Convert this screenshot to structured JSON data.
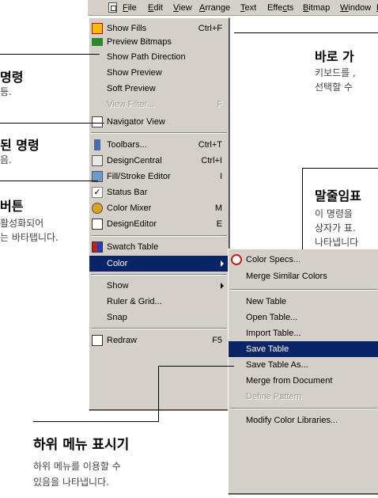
{
  "menubar": {
    "items": [
      {
        "pre": "",
        "u": "F",
        "post": "ile"
      },
      {
        "pre": "",
        "u": "E",
        "post": "dit"
      },
      {
        "pre": "",
        "u": "V",
        "post": "iew"
      },
      {
        "pre": "",
        "u": "A",
        "post": "rrange"
      },
      {
        "pre": "",
        "u": "T",
        "post": "ext"
      },
      {
        "pre": "Effe",
        "u": "c",
        "post": "ts"
      },
      {
        "pre": "",
        "u": "B",
        "post": "itmap"
      },
      {
        "pre": "",
        "u": "W",
        "post": "indow"
      },
      {
        "pre": "",
        "u": "H",
        "post": "elp"
      }
    ]
  },
  "view_menu": {
    "items": [
      {
        "label": "Show Fills",
        "shortcut": "Ctrl+F",
        "icon": "show-fills-icon"
      },
      {
        "label": "Preview Bitmaps",
        "shortcut": "",
        "icon": "preview-bitmaps-icon"
      },
      {
        "label": "Show Path Direction",
        "shortcut": ""
      },
      {
        "label": "Show Preview",
        "shortcut": ""
      },
      {
        "label": "Soft Preview",
        "shortcut": ""
      },
      {
        "label": "View Filter...",
        "shortcut": "F"
      },
      {
        "label": "Navigator View",
        "shortcut": "",
        "icon": "navigator-view-icon"
      },
      {
        "label": "Toolbars...",
        "shortcut": "Ctrl+T",
        "icon": "toolbars-icon"
      },
      {
        "label": "DesignCentral",
        "shortcut": "Ctrl+I",
        "icon": "designcentral-icon"
      },
      {
        "label": "Fill/Stroke Editor",
        "shortcut": "I",
        "icon": "fill-stroke-editor-icon"
      },
      {
        "label": "Status Bar",
        "shortcut": "",
        "icon": "check-icon"
      },
      {
        "label": "Color Mixer",
        "shortcut": "M",
        "icon": "color-mixer-icon"
      },
      {
        "label": "DesignEditor",
        "shortcut": "E",
        "icon": "design-editor-icon"
      },
      {
        "label": "Swatch Table",
        "shortcut": "",
        "icon": "swatch-table-icon"
      },
      {
        "label": "Color",
        "shortcut": ""
      },
      {
        "label": "Show",
        "shortcut": ""
      },
      {
        "label": "Ruler & Grid...",
        "shortcut": ""
      },
      {
        "label": "Snap",
        "shortcut": ""
      },
      {
        "label": "Redraw",
        "shortcut": "F5",
        "icon": "redraw-icon"
      }
    ]
  },
  "color_submenu": {
    "items": [
      {
        "label": "Color Specs...",
        "icon": "color-specs-icon"
      },
      {
        "label": "Merge Similar Colors"
      },
      {
        "label": "New Table"
      },
      {
        "label": "Open Table..."
      },
      {
        "label": "Import Table..."
      },
      {
        "label": "Save Table"
      },
      {
        "label": "Save Table As..."
      },
      {
        "label": "Merge from Document"
      },
      {
        "label": "Define Pattern"
      },
      {
        "label": "Modify Color Libraries..."
      }
    ]
  },
  "callouts": {
    "c1_title": "명령",
    "c1_desc": "등.",
    "c2_title": "된 명령",
    "c2_desc": "음.",
    "c3_title": "버튼",
    "c3_desc1": "활성화되어",
    "c3_desc2": "는 바타탭니다.",
    "c4_title": "바로 가",
    "c4_desc1": "키보드를 ,",
    "c4_desc2": "선택할 수",
    "c5_title": "말줄임표",
    "c5_desc1": "이 명령을",
    "c5_desc2": "상자가 표.",
    "c5_desc3": "나타냅니다",
    "c6_title": "하위 메뉴 표시기",
    "c6_desc1": "하위 메뉴를 이용할 수",
    "c6_desc2": "있음을 나타냅니다."
  },
  "colors": {
    "menu_bg": "#d4d0c8",
    "highlight": "#0a246a",
    "disabled": "#9c9a94"
  }
}
